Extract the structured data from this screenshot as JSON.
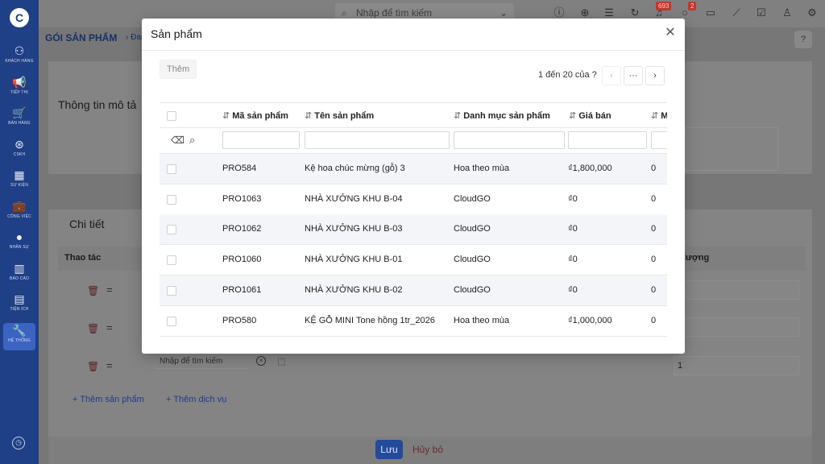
{
  "app": {
    "sidebar": {
      "items": [
        {
          "label": "KHÁCH HÀNG",
          "icon": "customers-icon"
        },
        {
          "label": "TIẾP THỊ",
          "icon": "megaphone-icon"
        },
        {
          "label": "BÁN HÀNG",
          "icon": "cart-icon"
        },
        {
          "label": "CSKH",
          "icon": "support-icon"
        },
        {
          "label": "SỰ KIỆN",
          "icon": "calendar-icon"
        },
        {
          "label": "CÔNG VIỆC",
          "icon": "briefcase-icon"
        },
        {
          "label": "NHÂN SỰ",
          "icon": "person-icon"
        },
        {
          "label": "BÁO CÁO",
          "icon": "report-icon"
        },
        {
          "label": "TIỆN ÍCH",
          "icon": "utilities-icon"
        },
        {
          "label": "HỆ THỐNG",
          "icon": "wrench-icon"
        }
      ]
    },
    "topbar": {
      "search_placeholder": "Nhập để tìm kiếm",
      "badges": {
        "notifications": "693",
        "messages": "2"
      }
    },
    "breadcrumb": {
      "root": "GÓI SẢN PHẨM",
      "rest": "Đan"
    },
    "sections": {
      "description_title": "Thông tin mô tả",
      "details_title": "Chi tiết"
    },
    "details_table": {
      "col_action": "Thao tác",
      "col_quantity_partial": "lượng",
      "row3_quantity": "1",
      "row_search_placeholder": "Nhập để tìm kiếm"
    },
    "links": {
      "add_product": "Thêm sản phẩm",
      "add_service": "Thêm dịch vụ"
    },
    "footer": {
      "save": "Lưu",
      "cancel": "Hủy bỏ"
    }
  },
  "modal": {
    "title": "Sản phẩm",
    "add_button": "Thêm",
    "pagination": {
      "text": "1 đến 20 của ?",
      "more": "···"
    },
    "columns": [
      "Mã sản phẩm",
      "Tên sản phẩm",
      "Danh mục sản phẩm",
      "Giá bán",
      "M"
    ],
    "rows": [
      {
        "code": "PRO584",
        "name": "Kệ hoa chúc mừng (gỗ) 3",
        "category": "Hoa theo mùa",
        "price": "₫1,800,000",
        "extra": "0"
      },
      {
        "code": "PRO1063",
        "name": "NHÀ XƯỞNG KHU B-04",
        "category": "CloudGO",
        "price": "₫0",
        "extra": "0"
      },
      {
        "code": "PRO1062",
        "name": "NHÀ XƯỞNG KHU B-03",
        "category": "CloudGO",
        "price": "₫0",
        "extra": "0"
      },
      {
        "code": "PRO1060",
        "name": "NHÀ XƯỞNG KHU B-01",
        "category": "CloudGO",
        "price": "₫0",
        "extra": "0"
      },
      {
        "code": "PRO1061",
        "name": "NHÀ XƯỞNG KHU B-02",
        "category": "CloudGO",
        "price": "₫0",
        "extra": "0"
      },
      {
        "code": "PRO580",
        "name": "KỆ GỖ MINI Tone hồng 1tr_2026",
        "category": "Hoa theo mùa",
        "price": "₫1,000,000",
        "extra": "0"
      }
    ]
  },
  "colors": {
    "accent": "#1f3f86",
    "primary_button": "#244a9a",
    "row_alt": "#f3f5f8"
  }
}
